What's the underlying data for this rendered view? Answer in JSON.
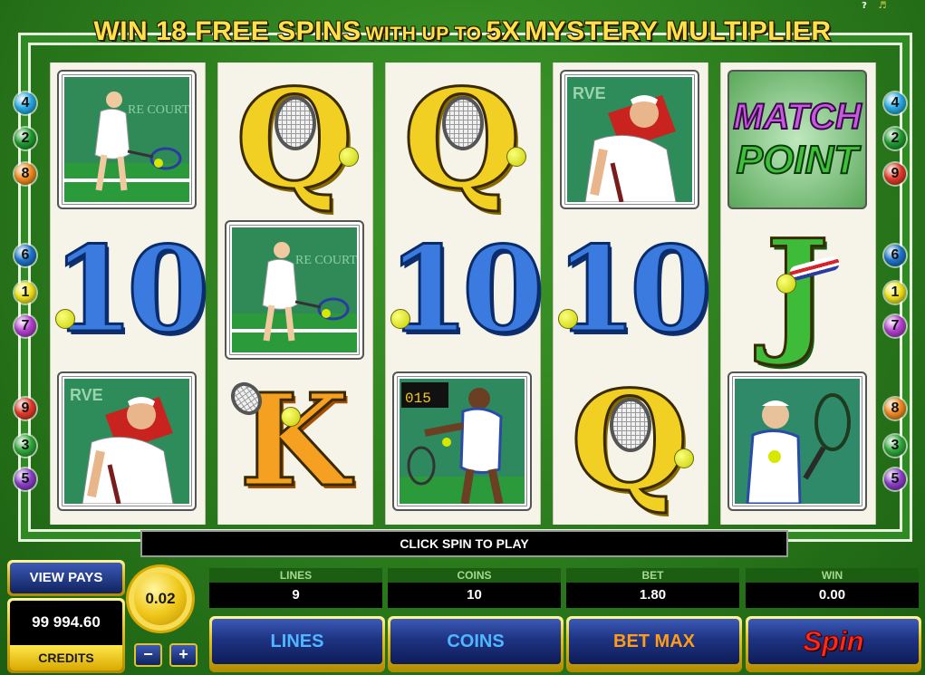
{
  "toolbar": {
    "help_label": "?",
    "sound_icon": "speaker-icon"
  },
  "banner": {
    "part1": "WIN 18 FREE SPINS",
    "part2": "WITH UP TO",
    "part3": "5X",
    "part4": "MYSTERY MULTIPLIER"
  },
  "paylines": {
    "left": [
      "4",
      "2",
      "8",
      "6",
      "1",
      "7",
      "9",
      "3",
      "5"
    ],
    "right": [
      "4",
      "2",
      "9",
      "6",
      "1",
      "7",
      "8",
      "3",
      "5"
    ],
    "colors": {
      "1": "#f1e21b",
      "2": "#1f9a2f",
      "3": "#2fa83a",
      "4": "#27a9e3",
      "5": "#8a3ec9",
      "6": "#1e74c9",
      "7": "#b33fcf",
      "8": "#f08a1f",
      "9": "#e23a2a"
    }
  },
  "reels": [
    [
      "female-player",
      "10",
      "male-player-serve"
    ],
    [
      "Q",
      "female-player",
      "K"
    ],
    [
      "Q",
      "10",
      "male-player-scoreboard"
    ],
    [
      "male-player-serve",
      "10",
      "Q"
    ],
    [
      "match-point",
      "J",
      "female-player-blonde"
    ]
  ],
  "symbols": {
    "match_top": "MATCH",
    "match_bottom": "POINT",
    "scoreboard_text": "015",
    "court_sign": "RE COURT",
    "rve": "RVE"
  },
  "message": "CLICK SPIN TO PLAY",
  "view_pays": "VIEW PAYS",
  "credits": {
    "value": "99 994.60",
    "label": "CREDITS"
  },
  "coin_size": "0.02",
  "coin_minus": "−",
  "coin_plus": "+",
  "stats": [
    {
      "label": "LINES",
      "value": "9"
    },
    {
      "label": "COINS",
      "value": "10"
    },
    {
      "label": "BET",
      "value": "1.80"
    },
    {
      "label": "WIN",
      "value": "0.00"
    }
  ],
  "buttons": {
    "lines": "LINES",
    "coins": "COINS",
    "bet_max": "BET MAX",
    "spin": "Spin"
  }
}
